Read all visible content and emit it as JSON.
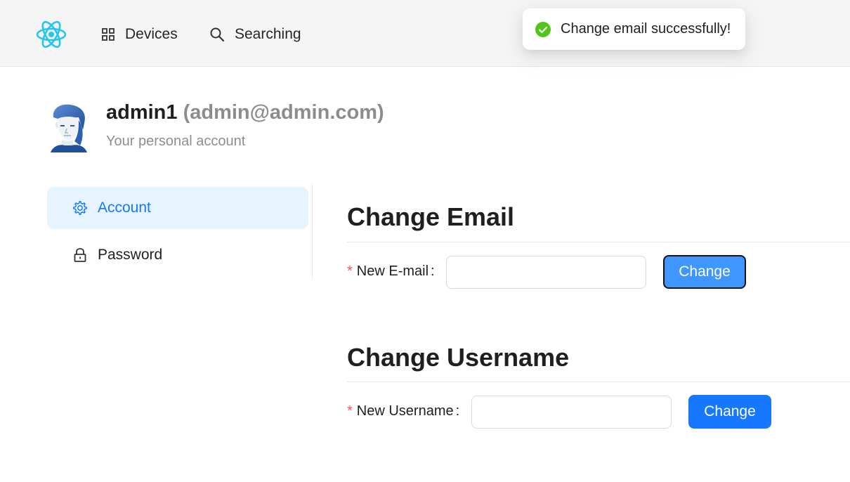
{
  "header": {
    "nav": [
      {
        "label": "Devices",
        "icon": "appstore-icon"
      },
      {
        "label": "Searching",
        "icon": "search-icon"
      }
    ]
  },
  "toast": {
    "message": "Change email successfully!",
    "icon": "check-circle-icon",
    "color": "#52c41a"
  },
  "profile": {
    "username": "admin1",
    "email": "(admin@admin.com)",
    "subtitle": "Your personal account"
  },
  "sidebar": {
    "items": [
      {
        "label": "Account",
        "icon": "gear-icon",
        "active": true
      },
      {
        "label": "Password",
        "icon": "lock-icon",
        "active": false
      }
    ]
  },
  "change_email": {
    "title": "Change Email",
    "label": "New E-mail",
    "required_mark": "*",
    "colon": ":",
    "value": "",
    "button_label": "Change"
  },
  "change_username": {
    "title": "Change Username",
    "label": "New Username",
    "required_mark": "*",
    "colon": ":",
    "value": "",
    "button_label": "Change"
  },
  "colors": {
    "primary": "#1677ff",
    "primary_hover": "#4096ff",
    "active_bg": "#e6f4ff",
    "required": "#ff4d4f"
  }
}
